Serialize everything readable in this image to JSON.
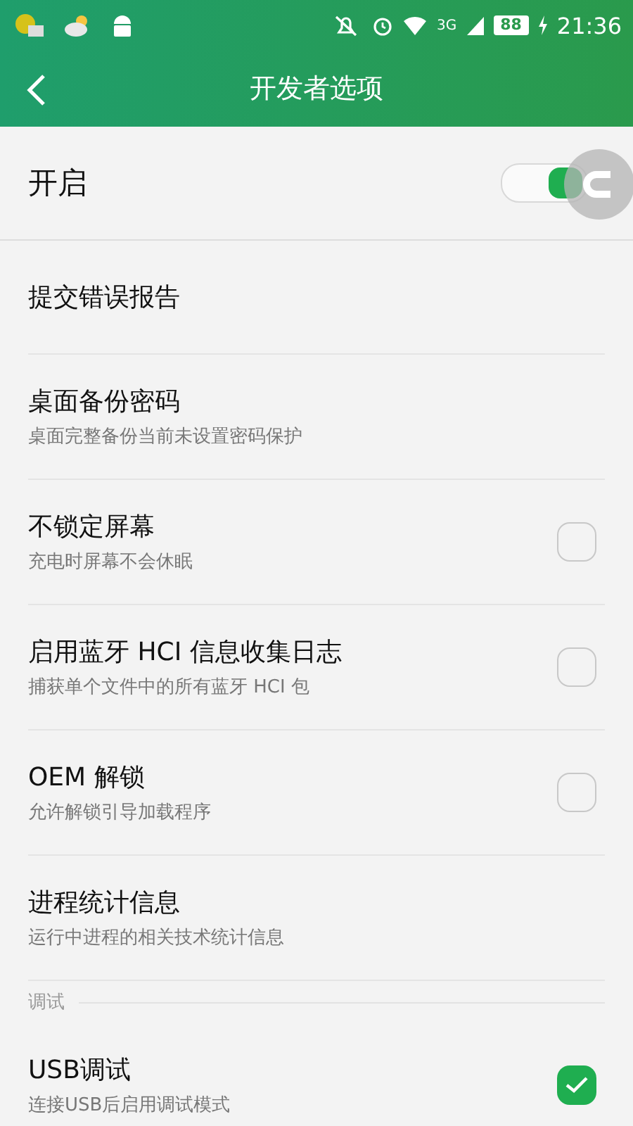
{
  "status_bar": {
    "network": "3G",
    "battery": "88",
    "time": "21:36"
  },
  "toolbar": {
    "title": "开发者选项"
  },
  "master_switch": {
    "label": "开启",
    "on": true
  },
  "items": [
    {
      "kind": "plain",
      "title": "提交错误报告"
    },
    {
      "kind": "plain",
      "title": "桌面备份密码",
      "subtitle": "桌面完整备份当前未设置密码保护"
    },
    {
      "kind": "checkbox",
      "title": "不锁定屏幕",
      "subtitle": "充电时屏幕不会休眠",
      "checked": false
    },
    {
      "kind": "checkbox",
      "title": "启用蓝牙 HCI 信息收集日志",
      "subtitle": "捕获单个文件中的所有蓝牙 HCI 包",
      "checked": false
    },
    {
      "kind": "checkbox",
      "title": "OEM 解锁",
      "subtitle": "允许解锁引导加载程序",
      "checked": false
    },
    {
      "kind": "plain",
      "title": "进程统计信息",
      "subtitle": "运行中进程的相关技术统计信息"
    },
    {
      "kind": "section",
      "title": "调试"
    },
    {
      "kind": "checkbox",
      "title": "USB调试",
      "subtitle": "连接USB后启用调试模式",
      "checked": true
    }
  ]
}
